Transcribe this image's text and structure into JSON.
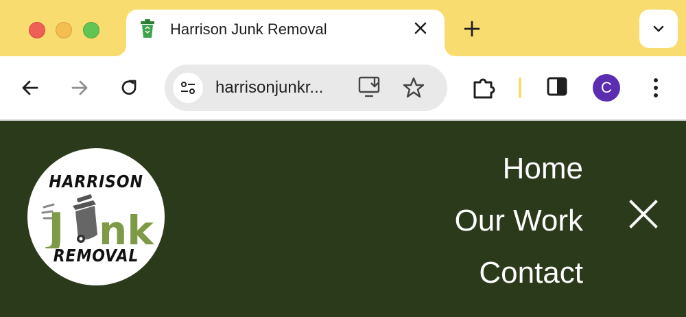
{
  "browser": {
    "tab_title": "Harrison Junk Removal",
    "url": "harrisonjunkr...",
    "profile_initial": "C",
    "accent_color": "#f9dc6f",
    "profile_color": "#5b2db0"
  },
  "icons": {
    "window_controls": [
      "close-dot",
      "minimize-dot",
      "maximize-dot"
    ],
    "tab": [
      "recycle-bin-favicon",
      "close-icon"
    ],
    "tabstrip": [
      "plus-icon",
      "chevron-down-icon"
    ],
    "toolbar": [
      "back-arrow-icon",
      "forward-arrow-icon",
      "reload-icon",
      "site-settings-icon",
      "install-app-icon",
      "star-icon",
      "extensions-icon",
      "side-panel-icon",
      "more-vert-icon"
    ]
  },
  "page": {
    "background_color": "#2c3a1c",
    "logo": {
      "line1": "HARRISON",
      "line2_part1": "J",
      "line2_part2": "nk",
      "line3": "REMOVAL",
      "accent_color": "#7f9a47"
    },
    "nav": {
      "items": [
        "Home",
        "Our Work",
        "Contact"
      ]
    },
    "close_label": "X"
  }
}
